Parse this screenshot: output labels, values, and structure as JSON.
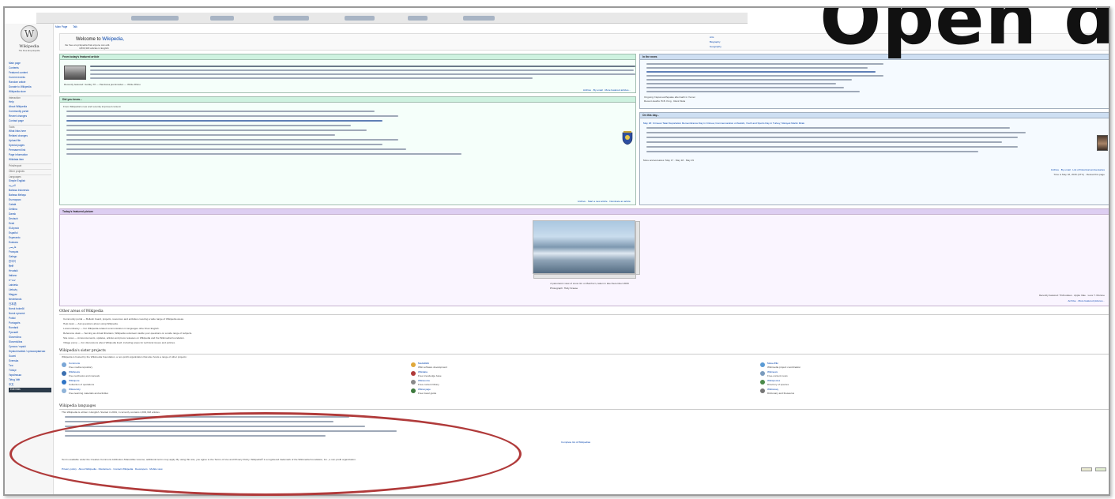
{
  "sidebar": {
    "logo_glyph": "W",
    "logo_title": "Wikipedia",
    "logo_subtitle": "The Free Encyclopedia",
    "nav": [
      {
        "label": "Main page",
        "kind": "link"
      },
      {
        "label": "Contents",
        "kind": "link"
      },
      {
        "label": "Featured content",
        "kind": "link"
      },
      {
        "label": "Current events",
        "kind": "link"
      },
      {
        "label": "Random article",
        "kind": "link"
      },
      {
        "label": "Donate to Wikipedia",
        "kind": "link"
      },
      {
        "label": "Wikipedia store",
        "kind": "link"
      },
      {
        "label": "Interaction",
        "kind": "section"
      },
      {
        "label": "Help",
        "kind": "link"
      },
      {
        "label": "About Wikipedia",
        "kind": "link"
      },
      {
        "label": "Community portal",
        "kind": "link"
      },
      {
        "label": "Recent changes",
        "kind": "link"
      },
      {
        "label": "Contact page",
        "kind": "link"
      },
      {
        "label": "Tools",
        "kind": "section"
      },
      {
        "label": "What links here",
        "kind": "link"
      },
      {
        "label": "Related changes",
        "kind": "link"
      },
      {
        "label": "Upload file",
        "kind": "link"
      },
      {
        "label": "Special pages",
        "kind": "link"
      },
      {
        "label": "Permanent link",
        "kind": "link"
      },
      {
        "label": "Page information",
        "kind": "link"
      },
      {
        "label": "Wikidata item",
        "kind": "link"
      },
      {
        "label": "Print/export",
        "kind": "section"
      },
      {
        "label": "Other projects",
        "kind": "section"
      },
      {
        "label": "Languages",
        "kind": "section"
      },
      {
        "label": "Simple English",
        "kind": "link"
      },
      {
        "label": "العربية",
        "kind": "link"
      },
      {
        "label": "Bahasa Indonesia",
        "kind": "link"
      },
      {
        "label": "Bahasa Melayu",
        "kind": "link"
      },
      {
        "label": "Български",
        "kind": "link"
      },
      {
        "label": "Català",
        "kind": "link"
      },
      {
        "label": "Čeština",
        "kind": "link"
      },
      {
        "label": "Dansk",
        "kind": "link"
      },
      {
        "label": "Deutsch",
        "kind": "link"
      },
      {
        "label": "Eesti",
        "kind": "link"
      },
      {
        "label": "Ελληνικά",
        "kind": "link"
      },
      {
        "label": "Español",
        "kind": "link"
      },
      {
        "label": "Esperanto",
        "kind": "link"
      },
      {
        "label": "Euskara",
        "kind": "link"
      },
      {
        "label": "فارسی",
        "kind": "link"
      },
      {
        "label": "Français",
        "kind": "link"
      },
      {
        "label": "Galego",
        "kind": "link"
      },
      {
        "label": "한국어",
        "kind": "link"
      },
      {
        "label": "हिन्दी",
        "kind": "link"
      },
      {
        "label": "Hrvatski",
        "kind": "link"
      },
      {
        "label": "Italiano",
        "kind": "link"
      },
      {
        "label": "עברית",
        "kind": "link"
      },
      {
        "label": "Latviešu",
        "kind": "link"
      },
      {
        "label": "Lietuvių",
        "kind": "link"
      },
      {
        "label": "Magyar",
        "kind": "link"
      },
      {
        "label": "Nederlands",
        "kind": "link"
      },
      {
        "label": "日本語",
        "kind": "link"
      },
      {
        "label": "Norsk bokmål",
        "kind": "link"
      },
      {
        "label": "Norsk nynorsk",
        "kind": "link"
      },
      {
        "label": "Polski",
        "kind": "link"
      },
      {
        "label": "Português",
        "kind": "link"
      },
      {
        "label": "Română",
        "kind": "link"
      },
      {
        "label": "Русский",
        "kind": "link"
      },
      {
        "label": "Slovenčina",
        "kind": "link"
      },
      {
        "label": "Slovenščina",
        "kind": "link"
      },
      {
        "label": "Српски / srpski",
        "kind": "link"
      },
      {
        "label": "Srpskohrvatski / српскохрватски",
        "kind": "link"
      },
      {
        "label": "Suomi",
        "kind": "link"
      },
      {
        "label": "Svenska",
        "kind": "link"
      },
      {
        "label": "ไทย",
        "kind": "link"
      },
      {
        "label": "Türkçe",
        "kind": "link"
      },
      {
        "label": "Українська",
        "kind": "link"
      },
      {
        "label": "Tiếng Việt",
        "kind": "link"
      },
      {
        "label": "中文",
        "kind": "link"
      },
      {
        "label": "Edit links",
        "kind": "strong"
      }
    ]
  },
  "tabs": {
    "main": "Main Page",
    "talk": "Talk"
  },
  "welcome": {
    "title_prefix": "Welcome to ",
    "title_link": "Wikipedia,",
    "line1": "the free encyclopedia that anyone can edit.",
    "line2": "4,833,318 articles in English",
    "portals": [
      "Arts",
      "Biography",
      "Geography"
    ]
  },
  "featured_article": {
    "header": "From today's featured article",
    "recent": "Recently featured: Godley Tif — Pandorea jasminoides — White Rhino",
    "footer": "Archive · By email · More featured articles..."
  },
  "in_the_news": {
    "header": "In the news",
    "ongoing": "Ongoing: Nepal earthquake aftermath in Yemen",
    "deaths": "Recent deaths: B.B. King · Rank Sklar"
  },
  "did_you_know": {
    "header": "Did you know...",
    "intro": "From Wikipedia's new and recently improved content:",
    "footer": "Archive · Start a new article · Nominate an article"
  },
  "on_this_day": {
    "header": "On this day...",
    "headline": "May 18: Crimean Tatar Deportation Remembrance Day in Crimea; Commemoration of Atatürk, Youth and Sports Day in Turkey; Ma'ayek Martin Dirak",
    "more": "More anniversaries: May 17 · May 18 · May 19",
    "footer": "Archive · By email · List of historical anniversaries",
    "time": "Time is May 18, 2015 (UTC) · Reload this page"
  },
  "featured_picture": {
    "header": "Today's featured picture",
    "caption": "A panoramic view of snow rim on Barrhorn, taken in late December 2009",
    "photo_credit": "Photograph: Holly Kraase",
    "recent": "Recently featured: Trichodetes · Apple Vale · Love Y. Monroe",
    "footer": "Archive · More featured pictures..."
  },
  "other_areas": {
    "title": "Other areas of Wikipedia",
    "items": [
      "Community portal — Bulletin board, projects, resources and activities covering a wide range of Wikipedia areas.",
      "Help desk — Ask questions about using Wikipedia.",
      "Local embassy — For Wikipedia-related communication in languages other than English.",
      "Reference desk — Serving as virtual librarians, Wikipedia volunteers tackle your questions on a wide range of subjects.",
      "Site news — Announcements, updates, articles and press releases on Wikipedia and the Wikimedia Foundation.",
      "Village pump — For discussions about Wikipedia itself, including areas for technical issues and policies."
    ]
  },
  "sister_projects": {
    "title": "Wikipedia's sister projects",
    "intro": "Wikipedia is hosted by the Wikimedia Foundation, a non-profit organization that also hosts a range of other projects:",
    "columns": [
      [
        {
          "name": "Commons",
          "desc": "Free media repository"
        },
        {
          "name": "Wikibooks",
          "desc": "Free textbooks and manuals"
        },
        {
          "name": "Wikiquote",
          "desc": "Collection of quotations"
        },
        {
          "name": "Wikiversity",
          "desc": "Free learning materials and activities"
        }
      ],
      [
        {
          "name": "MediaWiki",
          "desc": "Wiki software development"
        },
        {
          "name": "Wikidata",
          "desc": "Free knowledge base"
        },
        {
          "name": "Wikisource",
          "desc": "Free-content library"
        },
        {
          "name": "Wikivoyage",
          "desc": "Free travel guide"
        }
      ],
      [
        {
          "name": "Meta-Wiki",
          "desc": "Wikimedia project coordination"
        },
        {
          "name": "Wikinews",
          "desc": "Free-content news"
        },
        {
          "name": "Wikispecies",
          "desc": "Directory of species"
        },
        {
          "name": "Wiktionary",
          "desc": "Dictionary and thesaurus"
        }
      ]
    ]
  },
  "languages": {
    "title": "Wikipedia languages",
    "intro": "This Wikipedia is written in English. Started in 2001, it currently contains 4,833,318 articles.",
    "complete_list": "Complete list of Wikipedias"
  },
  "footer": {
    "license": "Text is available under the Creative Commons Attribution-ShareAlike License; additional terms may apply. By using this site, you agree to the Terms of Use and Privacy Policy. Wikipedia® is a registered trademark of the Wikimedia Foundation, Inc., a non-profit organization.",
    "links": "Privacy policy · About Wikipedia · Disclaimers · Contact Wikipedia · Developers · Mobile view"
  },
  "overlay": {
    "headline": "Open d"
  },
  "colors": {
    "annotation": "#b03a3a",
    "link": "#0645ad"
  }
}
